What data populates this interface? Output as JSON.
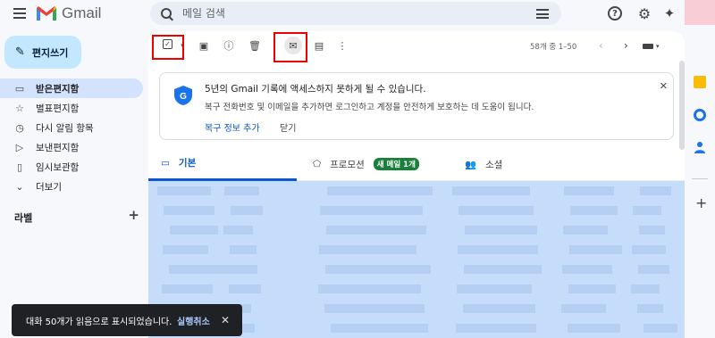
{
  "app": {
    "name": "Gmail"
  },
  "search": {
    "placeholder": "메일 검색"
  },
  "compose": {
    "label": "편지쓰기"
  },
  "nav": {
    "items": [
      {
        "label": "받은편지함",
        "icon": "inbox-icon",
        "active": true
      },
      {
        "label": "별표편지함",
        "icon": "star-icon"
      },
      {
        "label": "다시 알림 항목",
        "icon": "clock-icon"
      },
      {
        "label": "보낸편지함",
        "icon": "send-icon"
      },
      {
        "label": "임시보관함",
        "icon": "draft-icon"
      },
      {
        "label": "더보기",
        "icon": "chevron-down-icon"
      }
    ],
    "labels_heading": "라벨"
  },
  "toolbar": {
    "pagination": "58개 중 1–50"
  },
  "notice": {
    "title": "5년의 Gmail 기록에 액세스하지 못하게 될 수 있습니다.",
    "description": "복구 전화번호 및 이메일을 추가하면 로그인하고 계정을 안전하게 보호하는 데 도움이 됩니다.",
    "recover_link": "복구 정보 추가",
    "dismiss_link": "닫기"
  },
  "tabs": [
    {
      "label": "기본",
      "icon": "inbox-icon",
      "active": true
    },
    {
      "label": "프로모션",
      "icon": "tag-icon",
      "badge": "새 메일 1개"
    },
    {
      "label": "소셜",
      "icon": "people-icon"
    }
  ],
  "toast": {
    "message": "대화 50개가 읽음으로 표시되었습니다.",
    "undo": "실행취소"
  },
  "colors": {
    "compose_bg": "#c2e7ff",
    "accent": "#0b57d0",
    "highlight_red": "#ee0000",
    "badge_green": "#188038",
    "selected_rows": "#c5dcfa"
  }
}
